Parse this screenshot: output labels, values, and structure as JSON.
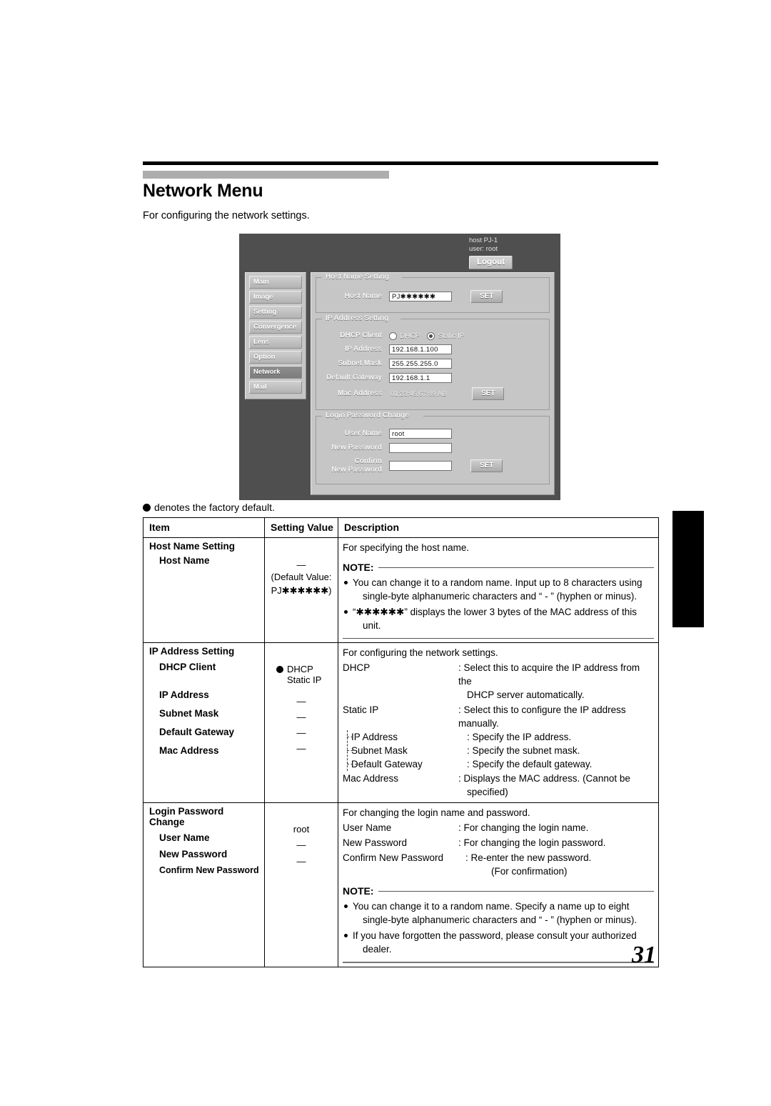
{
  "page": {
    "title": "Network Menu",
    "intro": "For configuring the network settings.",
    "factory_default_note": "denotes the factory default.",
    "page_number": "31"
  },
  "webui": {
    "host_label": "host PJ-1",
    "user_label": "user: root",
    "logout_button": "Logout",
    "nav": [
      {
        "label": "Main",
        "active": false
      },
      {
        "label": "Image",
        "active": false
      },
      {
        "label": "Setting",
        "active": false
      },
      {
        "label": "Convergence",
        "active": false
      },
      {
        "label": "Lens",
        "active": false
      },
      {
        "label": "Option",
        "active": false
      },
      {
        "label": "Network",
        "active": true
      },
      {
        "label": "Mail",
        "active": false
      }
    ],
    "host_name_setting": {
      "legend": "Host Name Setting",
      "host_name_label": "Host Name",
      "host_name_value": "PJ✱✱✱✱✱✱",
      "set_button": "SET"
    },
    "ip_address_setting": {
      "legend": "IP Address Setting",
      "dhcp_client_label": "DHCP Client",
      "radio_dhcp": "DHCP",
      "radio_static": "Static IP",
      "selected": "Static IP",
      "ip_address_label": "IP Address",
      "ip_address_value": "192.168.1.100",
      "subnet_mask_label": "Subnet Mask",
      "subnet_mask_value": "255.255.255.0",
      "default_gateway_label": "Default Gateway",
      "default_gateway_value": "192.168.1.1",
      "mac_address_label": "Mac Address",
      "mac_address_value": "01:23:45:67:89:AB",
      "set_button": "SET"
    },
    "login_password_change": {
      "legend": "Login Password Change",
      "user_name_label": "User Name",
      "user_name_value": "root",
      "new_password_label": "New Password",
      "new_password_value": "",
      "confirm_label_line1": "Confirm",
      "confirm_label_line2": "New Password",
      "confirm_value": "",
      "set_button": "SET"
    }
  },
  "table": {
    "headers": {
      "item": "Item",
      "value": "Setting Value",
      "description": "Description"
    },
    "rows": [
      {
        "item_head": "Host Name Setting",
        "item_sub": "Host Name",
        "value_dash": "—",
        "value_default_line1": "(Default Value:",
        "value_default_line2": "PJ✱✱✱✱✱✱)",
        "desc_intro": "For specifying the host name.",
        "note_title": "NOTE:",
        "notes": [
          {
            "line1": "You can change it to a random name. Input up to 8 characters using",
            "line2": "single-byte alphanumeric characters and “ - ” (hyphen or minus)."
          },
          {
            "line1": "“✱✱✱✱✱✱” displays the lower 3 bytes of the MAC address of this",
            "line2": "unit."
          }
        ]
      },
      {
        "item_head": "IP Address Setting",
        "items": [
          "DHCP Client",
          "IP Address",
          "Subnet Mask",
          "Default Gateway",
          "Mac Address"
        ],
        "value_dhcp": "DHCP",
        "value_static": "Static IP",
        "value_dashes": [
          "—",
          "—",
          "—",
          "—"
        ],
        "desc_intro": "For configuring the network settings.",
        "desc_rows": [
          {
            "left": "DHCP",
            "right": ": Select this to acquire the IP address from the",
            "right2": "DHCP server automatically."
          },
          {
            "left": "Static IP",
            "right": ": Select this to configure the IP address manually."
          },
          {
            "left": "IP Address",
            "tree": true,
            "right": ": Specify the IP address."
          },
          {
            "left": "Subnet Mask",
            "tree": true,
            "right": ": Specify the subnet mask."
          },
          {
            "left": "Default Gateway",
            "tree": true,
            "right": ": Specify the default gateway."
          },
          {
            "left": "Mac Address",
            "right": ": Displays the MAC address. (Cannot be",
            "right2": "specified)"
          }
        ]
      },
      {
        "item_head": "Login Password Change",
        "items": [
          "User Name",
          "New Password",
          "Confirm New Password"
        ],
        "value_user": "root",
        "value_dashes": [
          "—",
          "—"
        ],
        "desc_intro": "For changing the login name and password.",
        "desc_rows": [
          {
            "left": "User Name",
            "right": ": For changing the login name."
          },
          {
            "left": "New Password",
            "right": ": For changing the login password."
          },
          {
            "left": "Confirm New Password",
            "right": ": Re-enter the new password.",
            "right2": "(For confirmation)"
          }
        ],
        "note_title": "NOTE:",
        "notes": [
          {
            "line1": "You can change it to a random name. Specify a name up to eight",
            "line2": "single-byte alphanumeric characters and “ - ” (hyphen or minus)."
          },
          {
            "line1": "If you have forgotten the password, please consult your authorized",
            "line2": "dealer."
          }
        ]
      }
    ]
  }
}
